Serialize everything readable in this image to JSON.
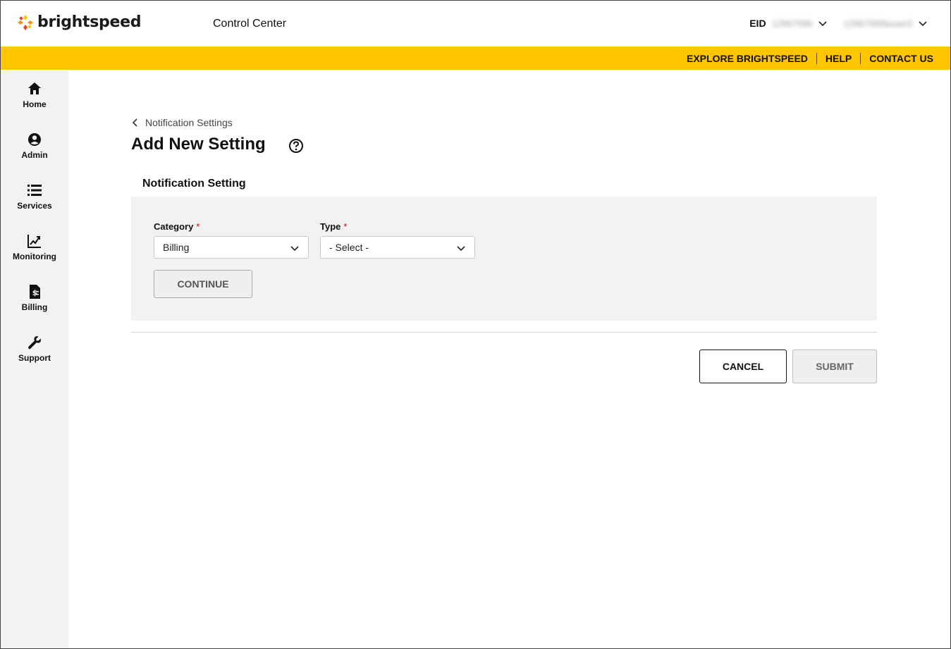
{
  "header": {
    "brand": "brightspeed",
    "app_title": "Control Center",
    "eid_label": "EID",
    "eid_value": "12967586",
    "user_value": "12967586buser3"
  },
  "utility_nav": [
    "EXPLORE BRIGHTSPEED",
    "HELP",
    "CONTACT US"
  ],
  "sidebar": {
    "items": [
      {
        "label": "Home",
        "icon": "home-icon"
      },
      {
        "label": "Admin",
        "icon": "user-circle-icon"
      },
      {
        "label": "Services",
        "icon": "list-icon"
      },
      {
        "label": "Monitoring",
        "icon": "chart-line-icon"
      },
      {
        "label": "Billing",
        "icon": "invoice-icon"
      },
      {
        "label": "Support",
        "icon": "wrench-icon"
      }
    ]
  },
  "main": {
    "breadcrumb": "Notification Settings",
    "page_title": "Add New Setting",
    "section_title": "Notification Setting",
    "form": {
      "category": {
        "label": "Category",
        "required_mark": "*",
        "value": "Billing"
      },
      "type": {
        "label": "Type",
        "required_mark": "*",
        "value": "- Select -"
      },
      "continue_label": "CONTINUE"
    },
    "actions": {
      "cancel_label": "CANCEL",
      "submit_label": "SUBMIT"
    }
  },
  "colors": {
    "accent_yellow": "#ffc600",
    "sidebar_bg": "#f2f2f2",
    "panel_bg": "#f2f2f2",
    "logo_orange": "#f7941d",
    "logo_red": "#e8412c",
    "logo_yellow": "#ffc600",
    "required_red": "#cc0000"
  }
}
